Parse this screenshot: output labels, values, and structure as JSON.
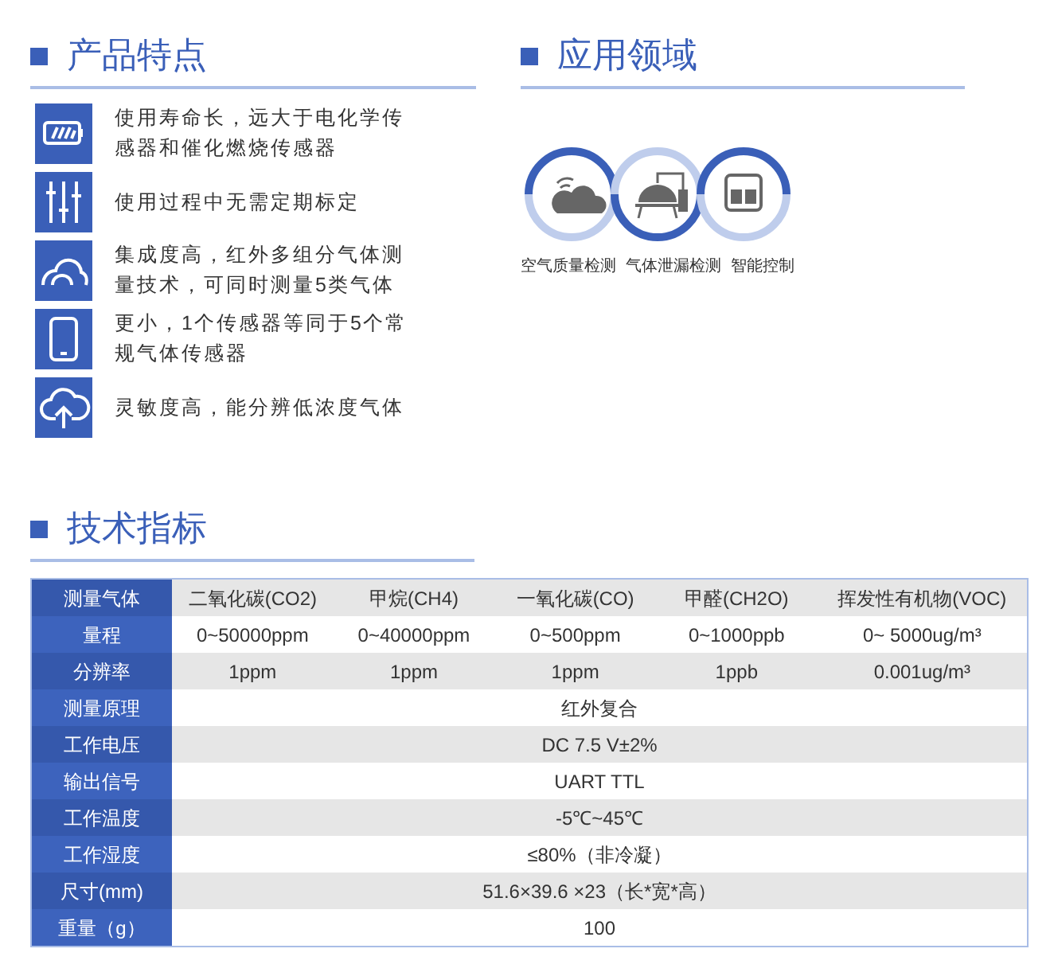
{
  "features_section": {
    "title": "产品特点",
    "items": [
      {
        "text": "使用寿命长，远大于电化学传感器和催化燃烧传感器"
      },
      {
        "text": "使用过程中无需定期标定"
      },
      {
        "text": "集成度高，红外多组分气体测量技术，可同时测量5类气体"
      },
      {
        "text": "更小，1个传感器等同于5个常规气体传感器"
      },
      {
        "text": "灵敏度高，能分辨低浓度气体"
      }
    ]
  },
  "applications_section": {
    "title": "应用领域",
    "labels": [
      "空气质量检测",
      "气体泄漏检测",
      "智能控制"
    ]
  },
  "specs_section": {
    "title": "技术指标",
    "rows": [
      {
        "label": "测量气体",
        "cells": [
          "二氧化碳(CO2)",
          "甲烷(CH4)",
          "一氧化碳(CO)",
          "甲醛(CH2O)",
          "挥发性有机物(VOC)"
        ]
      },
      {
        "label": "量程",
        "cells": [
          "0~50000ppm",
          "0~40000ppm",
          "0~500ppm",
          "0~1000ppb",
          "0~ 5000ug/m³"
        ]
      },
      {
        "label": "分辨率",
        "cells": [
          "1ppm",
          "1ppm",
          "1ppm",
          "1ppb",
          "0.001ug/m³"
        ]
      },
      {
        "label": "测量原理",
        "cells": [
          "红外复合"
        ]
      },
      {
        "label": "工作电压",
        "cells": [
          "DC 7.5 V±2%"
        ]
      },
      {
        "label": "输出信号",
        "cells": [
          "UART TTL"
        ]
      },
      {
        "label": "工作温度",
        "cells": [
          "-5℃~45℃"
        ]
      },
      {
        "label": "工作湿度",
        "cells": [
          "≤80%（非冷凝）"
        ]
      },
      {
        "label": "尺寸(mm)",
        "cells": [
          "51.6×39.6 ×23（长*宽*高）"
        ]
      },
      {
        "label": "重量（g）",
        "cells": [
          "100"
        ]
      }
    ]
  }
}
